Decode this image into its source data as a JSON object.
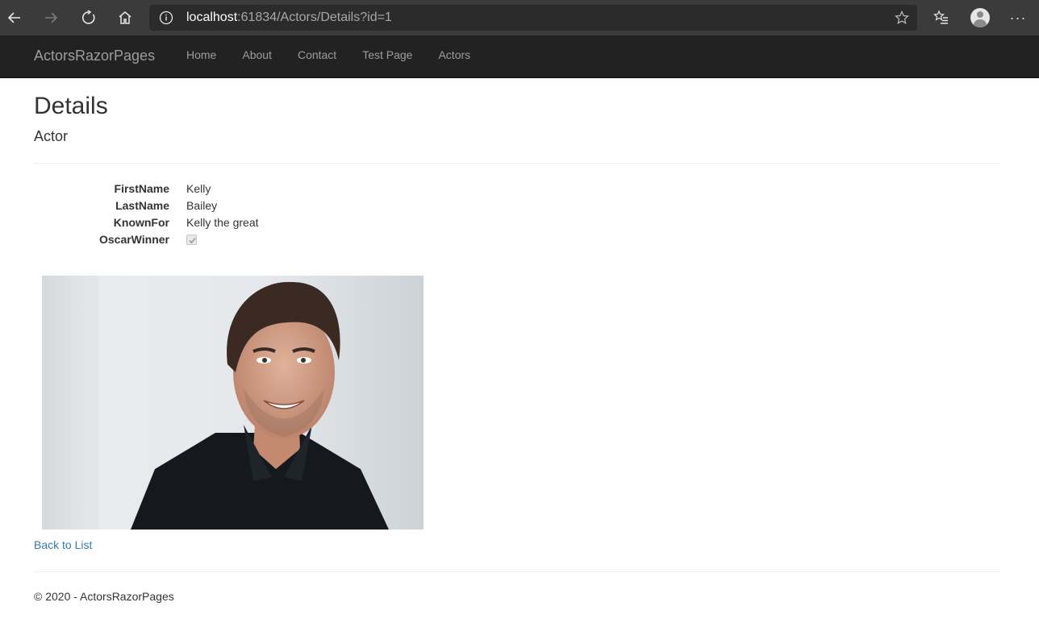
{
  "browser": {
    "address_host": "localhost",
    "address_rest": ":61834/Actors/Details?id=1"
  },
  "navbar": {
    "brand": "ActorsRazorPages",
    "links": [
      {
        "label": "Home"
      },
      {
        "label": "About"
      },
      {
        "label": "Contact"
      },
      {
        "label": "Test Page"
      },
      {
        "label": "Actors"
      }
    ]
  },
  "page": {
    "title": "Details",
    "subtitle": "Actor"
  },
  "details": {
    "first_name_label": "FirstName",
    "first_name_value": "Kelly",
    "last_name_label": "LastName",
    "last_name_value": "Bailey",
    "known_for_label": "KnownFor",
    "known_for_value": "Kelly the great",
    "oscar_winner_label": "OscarWinner",
    "oscar_winner_checked": true
  },
  "back_link": "Back to List",
  "footer": "© 2020 - ActorsRazorPages",
  "colors": {
    "browser_chrome": "#3b3b3b",
    "navbar_bg": "#222222",
    "nav_text": "#9d9d9d",
    "link": "#337ab7"
  },
  "icons": [
    "back-arrow-icon",
    "forward-arrow-icon",
    "refresh-icon",
    "home-icon",
    "info-icon",
    "star-icon",
    "favorites-icon",
    "profile-icon",
    "more-icon"
  ]
}
